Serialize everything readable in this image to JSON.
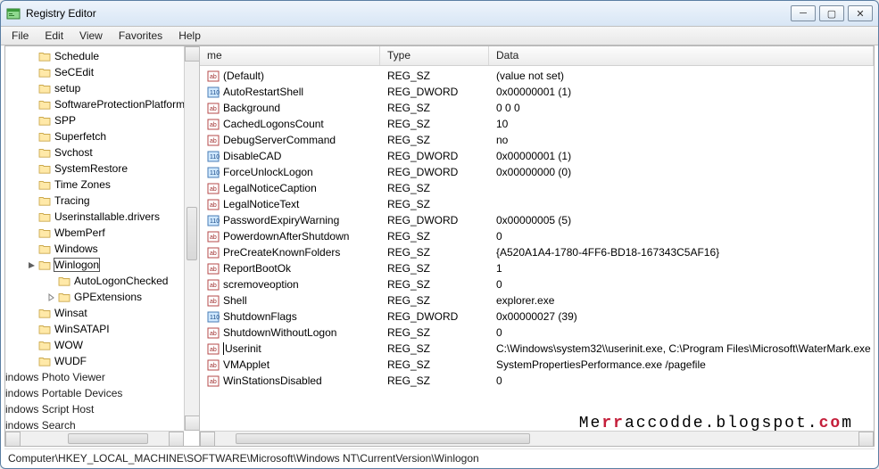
{
  "window": {
    "title": "Registry Editor"
  },
  "menu": {
    "file": "File",
    "edit": "Edit",
    "view": "View",
    "favorites": "Favorites",
    "help": "Help"
  },
  "tree": {
    "items": [
      {
        "label": "Schedule",
        "depth": 0
      },
      {
        "label": "SeCEdit",
        "depth": 0
      },
      {
        "label": "setup",
        "depth": 0
      },
      {
        "label": "SoftwareProtectionPlatform",
        "depth": 0
      },
      {
        "label": "SPP",
        "depth": 0
      },
      {
        "label": "Superfetch",
        "depth": 0
      },
      {
        "label": "Svchost",
        "depth": 0
      },
      {
        "label": "SystemRestore",
        "depth": 0
      },
      {
        "label": "Time Zones",
        "depth": 0
      },
      {
        "label": "Tracing",
        "depth": 0
      },
      {
        "label": "Userinstallable.drivers",
        "depth": 0
      },
      {
        "label": "WbemPerf",
        "depth": 0
      },
      {
        "label": "Windows",
        "depth": 0
      },
      {
        "label": "Winlogon",
        "depth": 0,
        "selected": true,
        "expanded": true
      },
      {
        "label": "AutoLogonChecked",
        "depth": 1
      },
      {
        "label": "GPExtensions",
        "depth": 1,
        "expandable": true
      },
      {
        "label": "Winsat",
        "depth": 0
      },
      {
        "label": "WinSATAPI",
        "depth": 0
      },
      {
        "label": "WOW",
        "depth": 0
      },
      {
        "label": "WUDF",
        "depth": 0
      }
    ],
    "truncated": [
      "indows Photo Viewer",
      "indows Portable Devices",
      "indows Script Host",
      "indows Search"
    ]
  },
  "columns": {
    "name": "me",
    "type": "Type",
    "data": "Data"
  },
  "values": [
    {
      "name": "(Default)",
      "type": "REG_SZ",
      "data": "(value not set)",
      "kind": "sz"
    },
    {
      "name": "AutoRestartShell",
      "type": "REG_DWORD",
      "data": "0x00000001 (1)",
      "kind": "dw"
    },
    {
      "name": "Background",
      "type": "REG_SZ",
      "data": "0 0 0",
      "kind": "sz"
    },
    {
      "name": "CachedLogonsCount",
      "type": "REG_SZ",
      "data": "10",
      "kind": "sz"
    },
    {
      "name": "DebugServerCommand",
      "type": "REG_SZ",
      "data": "no",
      "kind": "sz"
    },
    {
      "name": "DisableCAD",
      "type": "REG_DWORD",
      "data": "0x00000001 (1)",
      "kind": "dw"
    },
    {
      "name": "ForceUnlockLogon",
      "type": "REG_DWORD",
      "data": "0x00000000 (0)",
      "kind": "dw"
    },
    {
      "name": "LegalNoticeCaption",
      "type": "REG_SZ",
      "data": "",
      "kind": "sz"
    },
    {
      "name": "LegalNoticeText",
      "type": "REG_SZ",
      "data": "",
      "kind": "sz"
    },
    {
      "name": "PasswordExpiryWarning",
      "type": "REG_DWORD",
      "data": "0x00000005 (5)",
      "kind": "dw"
    },
    {
      "name": "PowerdownAfterShutdown",
      "type": "REG_SZ",
      "data": "0",
      "kind": "sz"
    },
    {
      "name": "PreCreateKnownFolders",
      "type": "REG_SZ",
      "data": "{A520A1A4-1780-4FF6-BD18-167343C5AF16}",
      "kind": "sz"
    },
    {
      "name": "ReportBootOk",
      "type": "REG_SZ",
      "data": "1",
      "kind": "sz"
    },
    {
      "name": "scremoveoption",
      "type": "REG_SZ",
      "data": "0",
      "kind": "sz"
    },
    {
      "name": "Shell",
      "type": "REG_SZ",
      "data": "explorer.exe",
      "kind": "sz"
    },
    {
      "name": "ShutdownFlags",
      "type": "REG_DWORD",
      "data": "0x00000027 (39)",
      "kind": "dw"
    },
    {
      "name": "ShutdownWithoutLogon",
      "type": "REG_SZ",
      "data": "0",
      "kind": "sz"
    },
    {
      "name": "Userinit",
      "type": "REG_SZ",
      "data": "C:\\Windows\\system32\\\\userinit.exe, ",
      "data2": "C:\\Program Files\\Microsoft\\WaterMark.exe",
      "kind": "sz",
      "highlight": true
    },
    {
      "name": "VMApplet",
      "type": "REG_SZ",
      "data": "SystemPropertiesPerformance.exe /pagefile",
      "kind": "sz"
    },
    {
      "name": "WinStationsDisabled",
      "type": "REG_SZ",
      "data": "0",
      "kind": "sz"
    }
  ],
  "statusbar": {
    "path": "Computer\\HKEY_LOCAL_MACHINE\\SOFTWARE\\Microsoft\\Windows NT\\CurrentVersion\\Winlogon"
  },
  "watermark": {
    "a": "Me",
    "b": "rr",
    "c": "accodde.blogspot.",
    "d": "co",
    "e": "m"
  }
}
